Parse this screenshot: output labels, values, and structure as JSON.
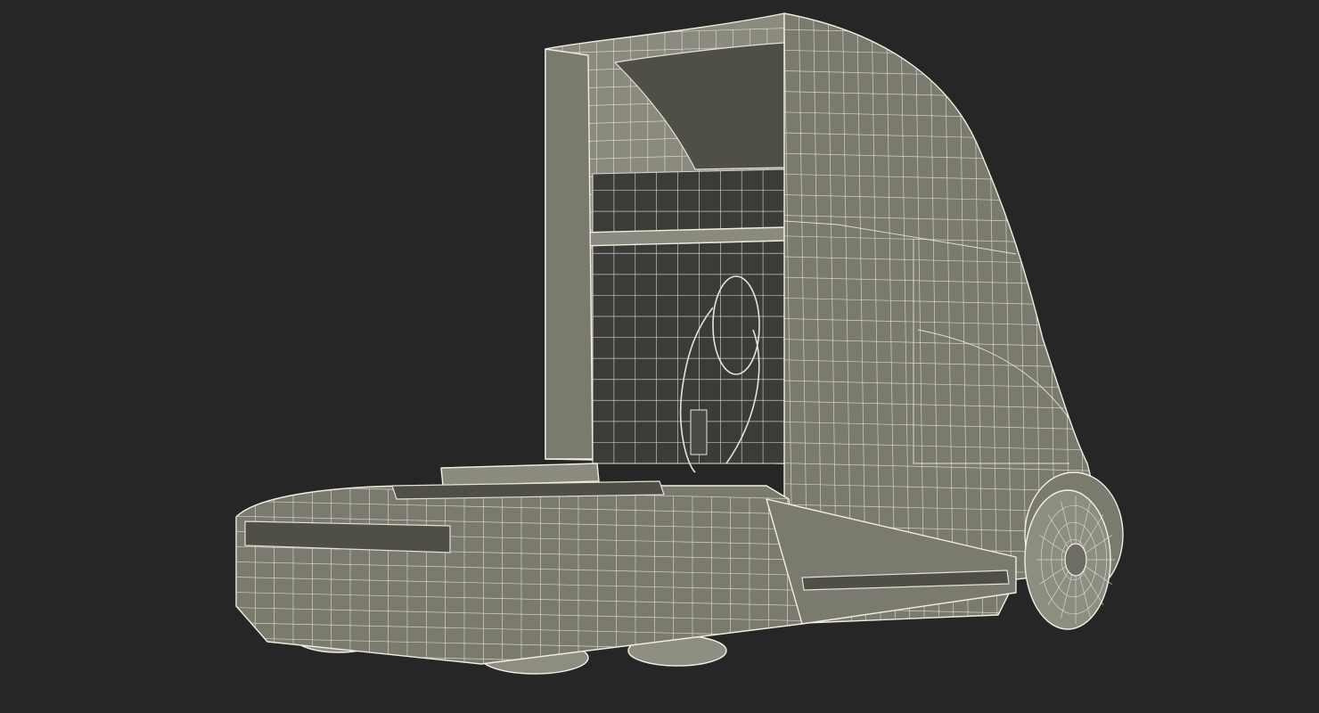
{
  "scene": {
    "background_color": "#262626",
    "mesh_fill_color": "#7a7a6e",
    "wire_color": "#f0efe2",
    "subject": "wireframe-truck-cab"
  }
}
